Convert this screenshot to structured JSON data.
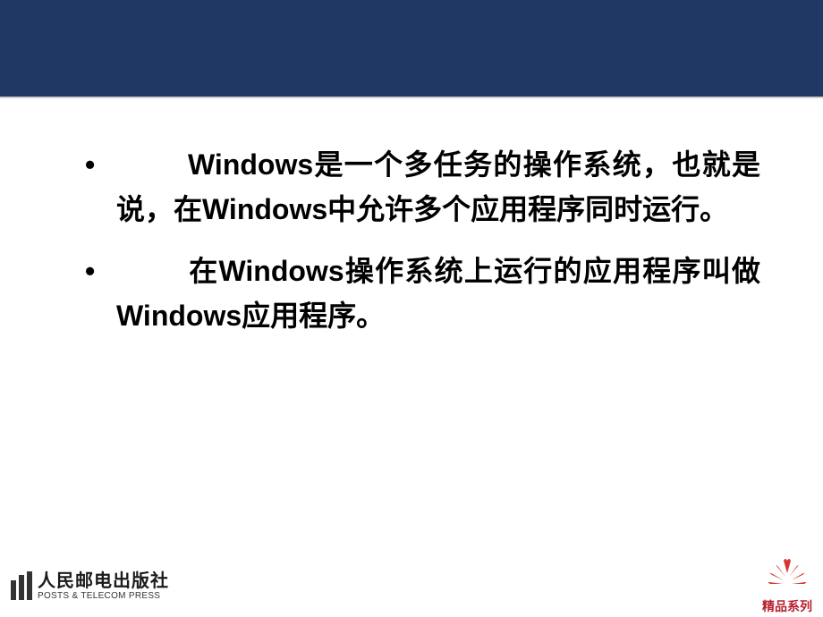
{
  "content": {
    "bullets": [
      "Windows是一个多任务的操作系统，也就是说，在Windows中允许多个应用程序同时运行。",
      "在Windows操作系统上运行的应用程序叫做Windows应用程序。"
    ]
  },
  "footer": {
    "publisher_cn": "人民邮电出版社",
    "publisher_en": "POSTS & TELECOM PRESS",
    "series_label": "精品系列"
  }
}
